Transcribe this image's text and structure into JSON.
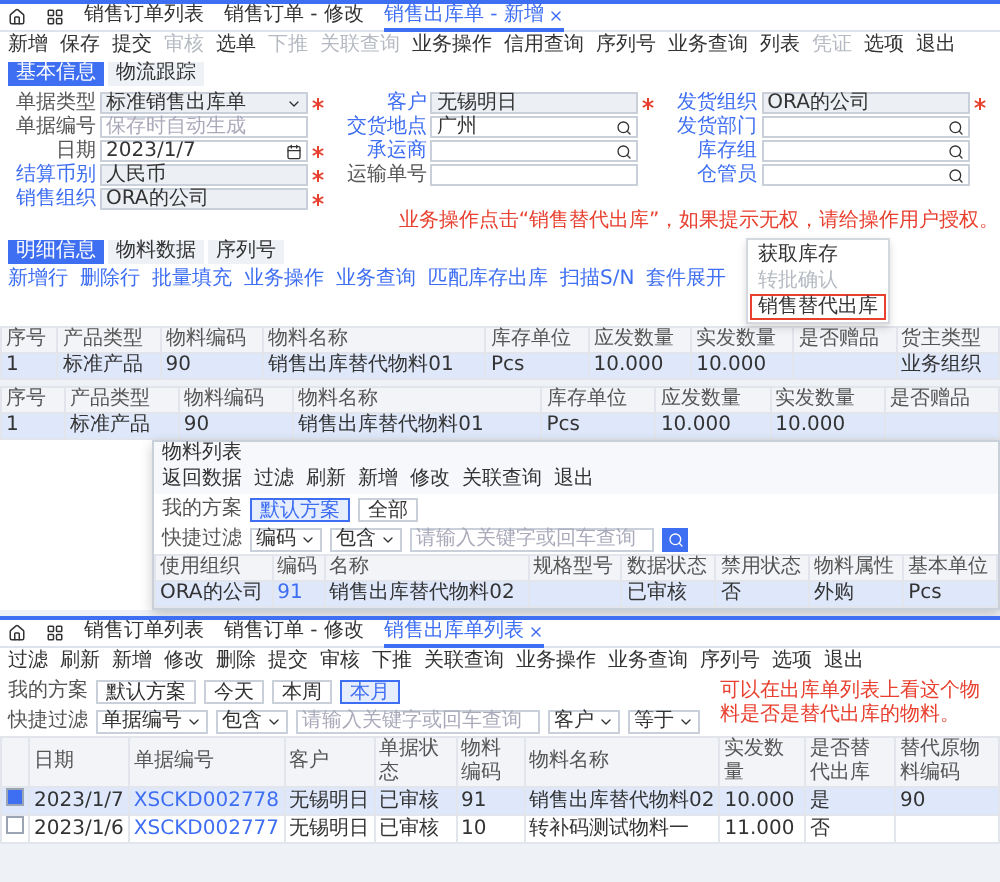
{
  "edit_form": {
    "tabs": [
      {
        "label": "销售订单列表",
        "selected": false
      },
      {
        "label": "销售订单 - 修改",
        "selected": false
      },
      {
        "label": "销售出库单 - 新增",
        "selected": true
      }
    ],
    "toolbar": [
      {
        "label": "新增",
        "disabled": false
      },
      {
        "label": "保存",
        "disabled": false
      },
      {
        "label": "提交",
        "disabled": false
      },
      {
        "label": "审核",
        "disabled": true
      },
      {
        "label": "选单",
        "disabled": false
      },
      {
        "label": "下推",
        "disabled": true
      },
      {
        "label": "关联查询",
        "disabled": true
      },
      {
        "label": "业务操作",
        "disabled": false
      },
      {
        "label": "信用查询",
        "disabled": false
      },
      {
        "label": "序列号",
        "disabled": false
      },
      {
        "label": "业务查询",
        "disabled": false
      },
      {
        "label": "列表",
        "disabled": false
      },
      {
        "label": "凭证",
        "disabled": true
      },
      {
        "label": "选项",
        "disabled": false
      },
      {
        "label": "退出",
        "disabled": false
      }
    ],
    "form_tabs": [
      {
        "label": "基本信息",
        "selected": true
      },
      {
        "label": "物流跟踪",
        "selected": false
      }
    ],
    "form_columns": [
      [
        {
          "label": "单据类型",
          "kind": "select",
          "value": "标准销售出库单",
          "required": true,
          "link": false,
          "readonly": true
        },
        {
          "label": "单据编号",
          "kind": "text",
          "placeholder": "保存时自动生成",
          "required": false,
          "link": false,
          "readonly": false
        },
        {
          "label": "日期",
          "kind": "date",
          "value": "2023/1/7",
          "required": true,
          "link": false,
          "readonly": false
        },
        {
          "label": "结算币别",
          "kind": "text",
          "value": "人民币",
          "required": true,
          "link": true,
          "readonly": true
        },
        {
          "label": "销售组织",
          "kind": "text",
          "value": "ORA的公司",
          "required": true,
          "link": true,
          "readonly": true
        }
      ],
      [
        {
          "label": "客户",
          "kind": "text",
          "value": "无锡明日",
          "required": true,
          "link": true,
          "readonly": true
        },
        {
          "label": "交货地点",
          "kind": "lookup",
          "value": "广州",
          "required": false,
          "link": true,
          "readonly": false
        },
        {
          "label": "承运商",
          "kind": "lookup",
          "required": false,
          "link": true,
          "readonly": false
        },
        {
          "label": "运输单号",
          "kind": "text",
          "required": false,
          "link": false,
          "readonly": false
        }
      ],
      [
        {
          "label": "发货组织",
          "kind": "text",
          "value": "ORA的公司",
          "required": true,
          "link": true,
          "readonly": true
        },
        {
          "label": "发货部门",
          "kind": "lookup",
          "required": false,
          "link": true,
          "readonly": false
        },
        {
          "label": "库存组",
          "kind": "lookup",
          "required": false,
          "link": true,
          "readonly": false
        },
        {
          "label": "仓管员",
          "kind": "lookup",
          "required": false,
          "link": true,
          "readonly": false
        }
      ]
    ],
    "note": "业务操作点击“销售替代出库”，如果提示无权，请给操作用户授权。",
    "detail_tabs": [
      {
        "label": "明细信息",
        "selected": true
      },
      {
        "label": "物料数据",
        "selected": false
      },
      {
        "label": "序列号",
        "selected": false
      }
    ],
    "detail_toolbar": [
      {
        "label": "新增行",
        "disabled": false
      },
      {
        "label": "删除行",
        "disabled": false
      },
      {
        "label": "批量填充",
        "disabled": false
      },
      {
        "label": "业务操作",
        "disabled": false
      },
      {
        "label": "业务查询",
        "disabled": false
      },
      {
        "label": "匹配库存出库",
        "disabled": false
      },
      {
        "label": "扫描S/N",
        "disabled": false
      },
      {
        "label": "套件展开",
        "disabled": false
      }
    ],
    "menu": [
      {
        "label": "获取库存",
        "disabled": false,
        "selected": false
      },
      {
        "label": "转批确认",
        "disabled": true,
        "selected": false
      },
      {
        "label": "销售替代出库",
        "disabled": false,
        "selected": true
      }
    ],
    "table": {
      "columns": [
        "序号",
        "产品类型",
        "物料编码",
        "物料名称",
        "库存单位",
        "应发数量",
        "实发数量",
        "是否赠品",
        "货主类型"
      ],
      "rows": [
        {
          "selected": true,
          "cells": [
            "1",
            "标准产品",
            "90",
            "销售出库替代物料01",
            "Pcs",
            "10.000",
            "10.000",
            "",
            "业务组织"
          ]
        }
      ]
    }
  },
  "replaced_row": {
    "columns": [
      "序号",
      "产品类型",
      "物料编码",
      "物料名称",
      "库存单位",
      "应发数量",
      "实发数量",
      "是否赠品"
    ],
    "rows": [
      {
        "selected": true,
        "cells": [
          "1",
          "标准产品",
          "90",
          "销售出库替代物料01",
          "Pcs",
          "10.000",
          "10.000",
          ""
        ]
      }
    ]
  },
  "material_list": {
    "title": "物料列表",
    "toolbar": [
      {
        "label": "返回数据",
        "disabled": false
      },
      {
        "label": "过滤",
        "disabled": false
      },
      {
        "label": "刷新",
        "disabled": false
      },
      {
        "label": "新增",
        "disabled": false
      },
      {
        "label": "修改",
        "disabled": false
      },
      {
        "label": "关联查询",
        "disabled": false
      },
      {
        "label": "退出",
        "disabled": false
      }
    ],
    "scheme_label": "我的方案",
    "schemes": [
      {
        "label": "默认方案",
        "selected": true
      },
      {
        "label": "全部",
        "selected": false
      }
    ],
    "filter_label": "快捷过滤",
    "filter_field": "编码",
    "filter_op": "包含",
    "filter_placeholder": "请输入关键字或回车查询",
    "columns": [
      "使用组织",
      "编码",
      "名称",
      "规格型号",
      "数据状态",
      "禁用状态",
      "物料属性",
      "基本单位"
    ],
    "rows": [
      {
        "selected": true,
        "cells": [
          "ORA的公司",
          "91",
          "销售出库替代物料02",
          "",
          "已审核",
          "否",
          "外购",
          "Pcs"
        ]
      }
    ]
  },
  "outbound_list": {
    "tabs": [
      {
        "label": "销售订单列表",
        "selected": false
      },
      {
        "label": "销售订单 - 修改",
        "selected": false
      },
      {
        "label": "销售出库单列表",
        "selected": true
      }
    ],
    "toolbar": [
      {
        "label": "过滤",
        "disabled": false
      },
      {
        "label": "刷新",
        "disabled": false
      },
      {
        "label": "新增",
        "disabled": false
      },
      {
        "label": "修改",
        "disabled": false
      },
      {
        "label": "删除",
        "disabled": false
      },
      {
        "label": "提交",
        "disabled": false
      },
      {
        "label": "审核",
        "disabled": false
      },
      {
        "label": "下推",
        "disabled": false
      },
      {
        "label": "关联查询",
        "disabled": false
      },
      {
        "label": "业务操作",
        "disabled": false
      },
      {
        "label": "业务查询",
        "disabled": false
      },
      {
        "label": "序列号",
        "disabled": false
      },
      {
        "label": "选项",
        "disabled": false
      },
      {
        "label": "退出",
        "disabled": false
      }
    ],
    "scheme_label": "我的方案",
    "schemes": [
      {
        "label": "默认方案",
        "selected": false
      },
      {
        "label": "今天",
        "selected": false
      },
      {
        "label": "本周",
        "selected": false
      },
      {
        "label": "本月",
        "selected": true
      }
    ],
    "filter_label": "快捷过滤",
    "filter_field": "单据编号",
    "filter_op": "包含",
    "filter_placeholder": "请输入关键字或回车查询",
    "filter_field_2": "客户",
    "filter_op_2": "等于",
    "note": "可以在出库单列表上看这个物料是否是替代出库的物料。",
    "columns": [
      "日期",
      "单据编号",
      "客户",
      "单据状态",
      "物料编码",
      "物料名称",
      "实发数量",
      "是否替代出库",
      "替代原物料编码"
    ],
    "rows": [
      {
        "checked": true,
        "selected": true,
        "cells": [
          "2023/1/7",
          "XSCKD002778",
          "无锡明日",
          "已审核",
          "91",
          "销售出库替代物料02",
          "10.000",
          "是",
          "90"
        ]
      },
      {
        "checked": false,
        "selected": false,
        "cells": [
          "2023/1/6",
          "XSCKD002777",
          "无锡明日",
          "已审核",
          "10",
          "转补码测试物料一",
          "11.000",
          "否",
          ""
        ]
      }
    ]
  }
}
